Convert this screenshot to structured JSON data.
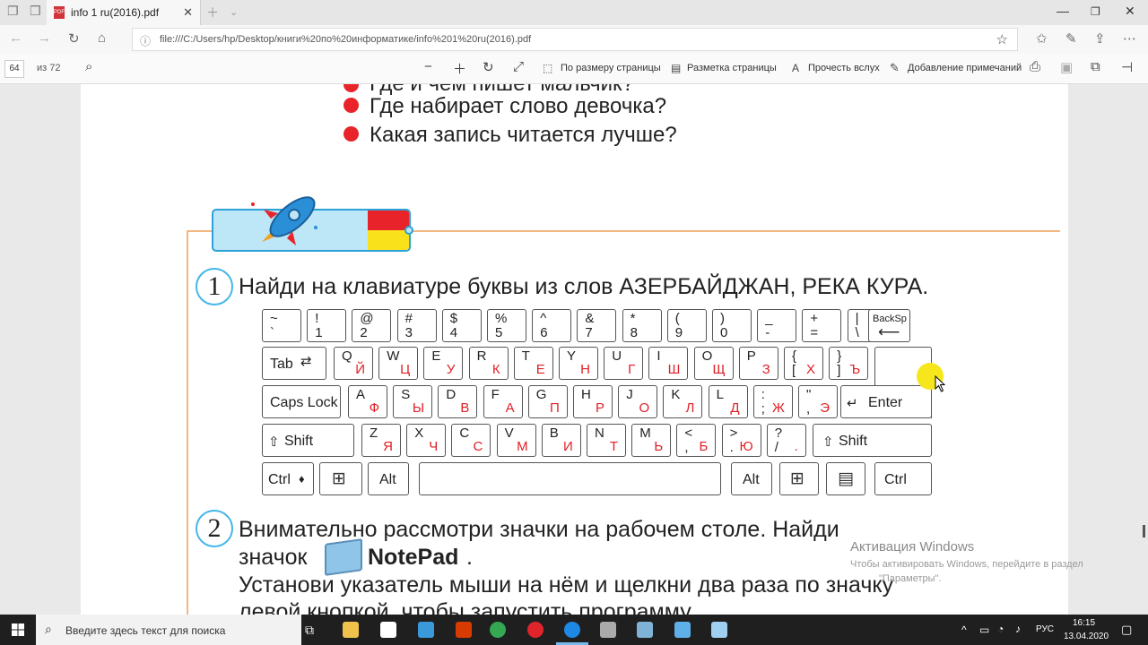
{
  "browser": {
    "tab_title": "info 1 ru(2016).pdf",
    "url": "file:///C:/Users/hp/Desktop/книги%20по%20информатике/info%201%20ru(2016).pdf"
  },
  "pdf_toolbar": {
    "page_current": "64",
    "page_total": "из 72",
    "fit_page": "По размеру страницы",
    "layout": "Разметка страницы",
    "read_aloud": "Прочесть вслух",
    "add_notes": "Добавление примечаний"
  },
  "document": {
    "partial_line": "Где и чем пишет мальчик?",
    "questions": [
      "Где набирает слово девочка?",
      "Какая запись читается лучше?"
    ],
    "task1_number": "1",
    "task1_text": "Найди на клавиатуре буквы из слов АЗЕРБАЙДЖАН, РЕКА КУРА.",
    "task2_number": "2",
    "task2_line1": "Внимательно рассмотри значки на рабочем столе. Найди",
    "task2_line2_prefix": "значок",
    "task2_notepad": "NotePad",
    "task2_line2_suffix": ".",
    "task2_line3": "Установи указатель мыши на нём и щелкни два раза по значку",
    "task2_line4": "левой кнопкой, чтобы запустить программу."
  },
  "keyboard": {
    "row1": [
      {
        "top": "~",
        "bot": "`"
      },
      {
        "top": "!",
        "bot": "1"
      },
      {
        "top": "@",
        "bot": "2"
      },
      {
        "top": "#",
        "bot": "3"
      },
      {
        "top": "$",
        "bot": "4"
      },
      {
        "top": "%",
        "bot": "5"
      },
      {
        "top": "^",
        "bot": "6"
      },
      {
        "top": "&",
        "bot": "7"
      },
      {
        "top": "*",
        "bot": "8"
      },
      {
        "top": "(",
        "bot": "9"
      },
      {
        "top": ")",
        "bot": "0"
      },
      {
        "top": "_",
        "bot": "-"
      },
      {
        "top": "+",
        "bot": "="
      },
      {
        "top": "|",
        "bot": "\\"
      }
    ],
    "backspace": "BackSp",
    "tab": "Tab",
    "row2": [
      {
        "lat": "Q",
        "ru": "Й"
      },
      {
        "lat": "W",
        "ru": "Ц"
      },
      {
        "lat": "E",
        "ru": "У"
      },
      {
        "lat": "R",
        "ru": "К"
      },
      {
        "lat": "T",
        "ru": "Е"
      },
      {
        "lat": "Y",
        "ru": "Н"
      },
      {
        "lat": "U",
        "ru": "Г"
      },
      {
        "lat": "I",
        "ru": "Ш"
      },
      {
        "lat": "O",
        "ru": "Щ"
      },
      {
        "lat": "P",
        "ru": "З"
      },
      {
        "lat": "{",
        "lat2": "[",
        "ru": "Х"
      },
      {
        "lat": "}",
        "lat2": "]",
        "ru": "Ъ"
      }
    ],
    "caps": "Caps Lock",
    "row3": [
      {
        "lat": "A",
        "ru": "Ф"
      },
      {
        "lat": "S",
        "ru": "Ы"
      },
      {
        "lat": "D",
        "ru": "В"
      },
      {
        "lat": "F",
        "ru": "А"
      },
      {
        "lat": "G",
        "ru": "П"
      },
      {
        "lat": "H",
        "ru": "Р"
      },
      {
        "lat": "J",
        "ru": "О"
      },
      {
        "lat": "K",
        "ru": "Л"
      },
      {
        "lat": "L",
        "ru": "Д"
      },
      {
        "lat": ":",
        "lat2": ";",
        "ru": "Ж"
      },
      {
        "lat": "\"",
        "lat2": ",",
        "ru": "Э"
      }
    ],
    "enter": "Enter",
    "shift_left": "Shift",
    "row4": [
      {
        "lat": "Z",
        "ru": "Я"
      },
      {
        "lat": "X",
        "ru": "Ч"
      },
      {
        "lat": "C",
        "ru": "С"
      },
      {
        "lat": "V",
        "ru": "М"
      },
      {
        "lat": "B",
        "ru": "И"
      },
      {
        "lat": "N",
        "ru": "Т"
      },
      {
        "lat": "M",
        "ru": "Ь"
      },
      {
        "lat": "<",
        "lat2": ",",
        "ru": "Б"
      },
      {
        "lat": ">",
        "lat2": ".",
        "ru": "Ю"
      },
      {
        "lat": "?",
        "lat2": "/",
        "ru": "."
      }
    ],
    "shift_right": "Shift",
    "ctrl_left": "Ctrl",
    "alt_left": "Alt",
    "alt_right": "Alt",
    "ctrl_right": "Ctrl"
  },
  "watermark": {
    "title": "Активация Windows",
    "line1": "Чтобы активировать Windows, перейдите в раздел",
    "line2": "\"Параметры\"."
  },
  "taskbar": {
    "search_placeholder": "Введите здесь текст для поиска",
    "lang": "РУС",
    "time": "16:15",
    "date": "13.04.2020"
  }
}
